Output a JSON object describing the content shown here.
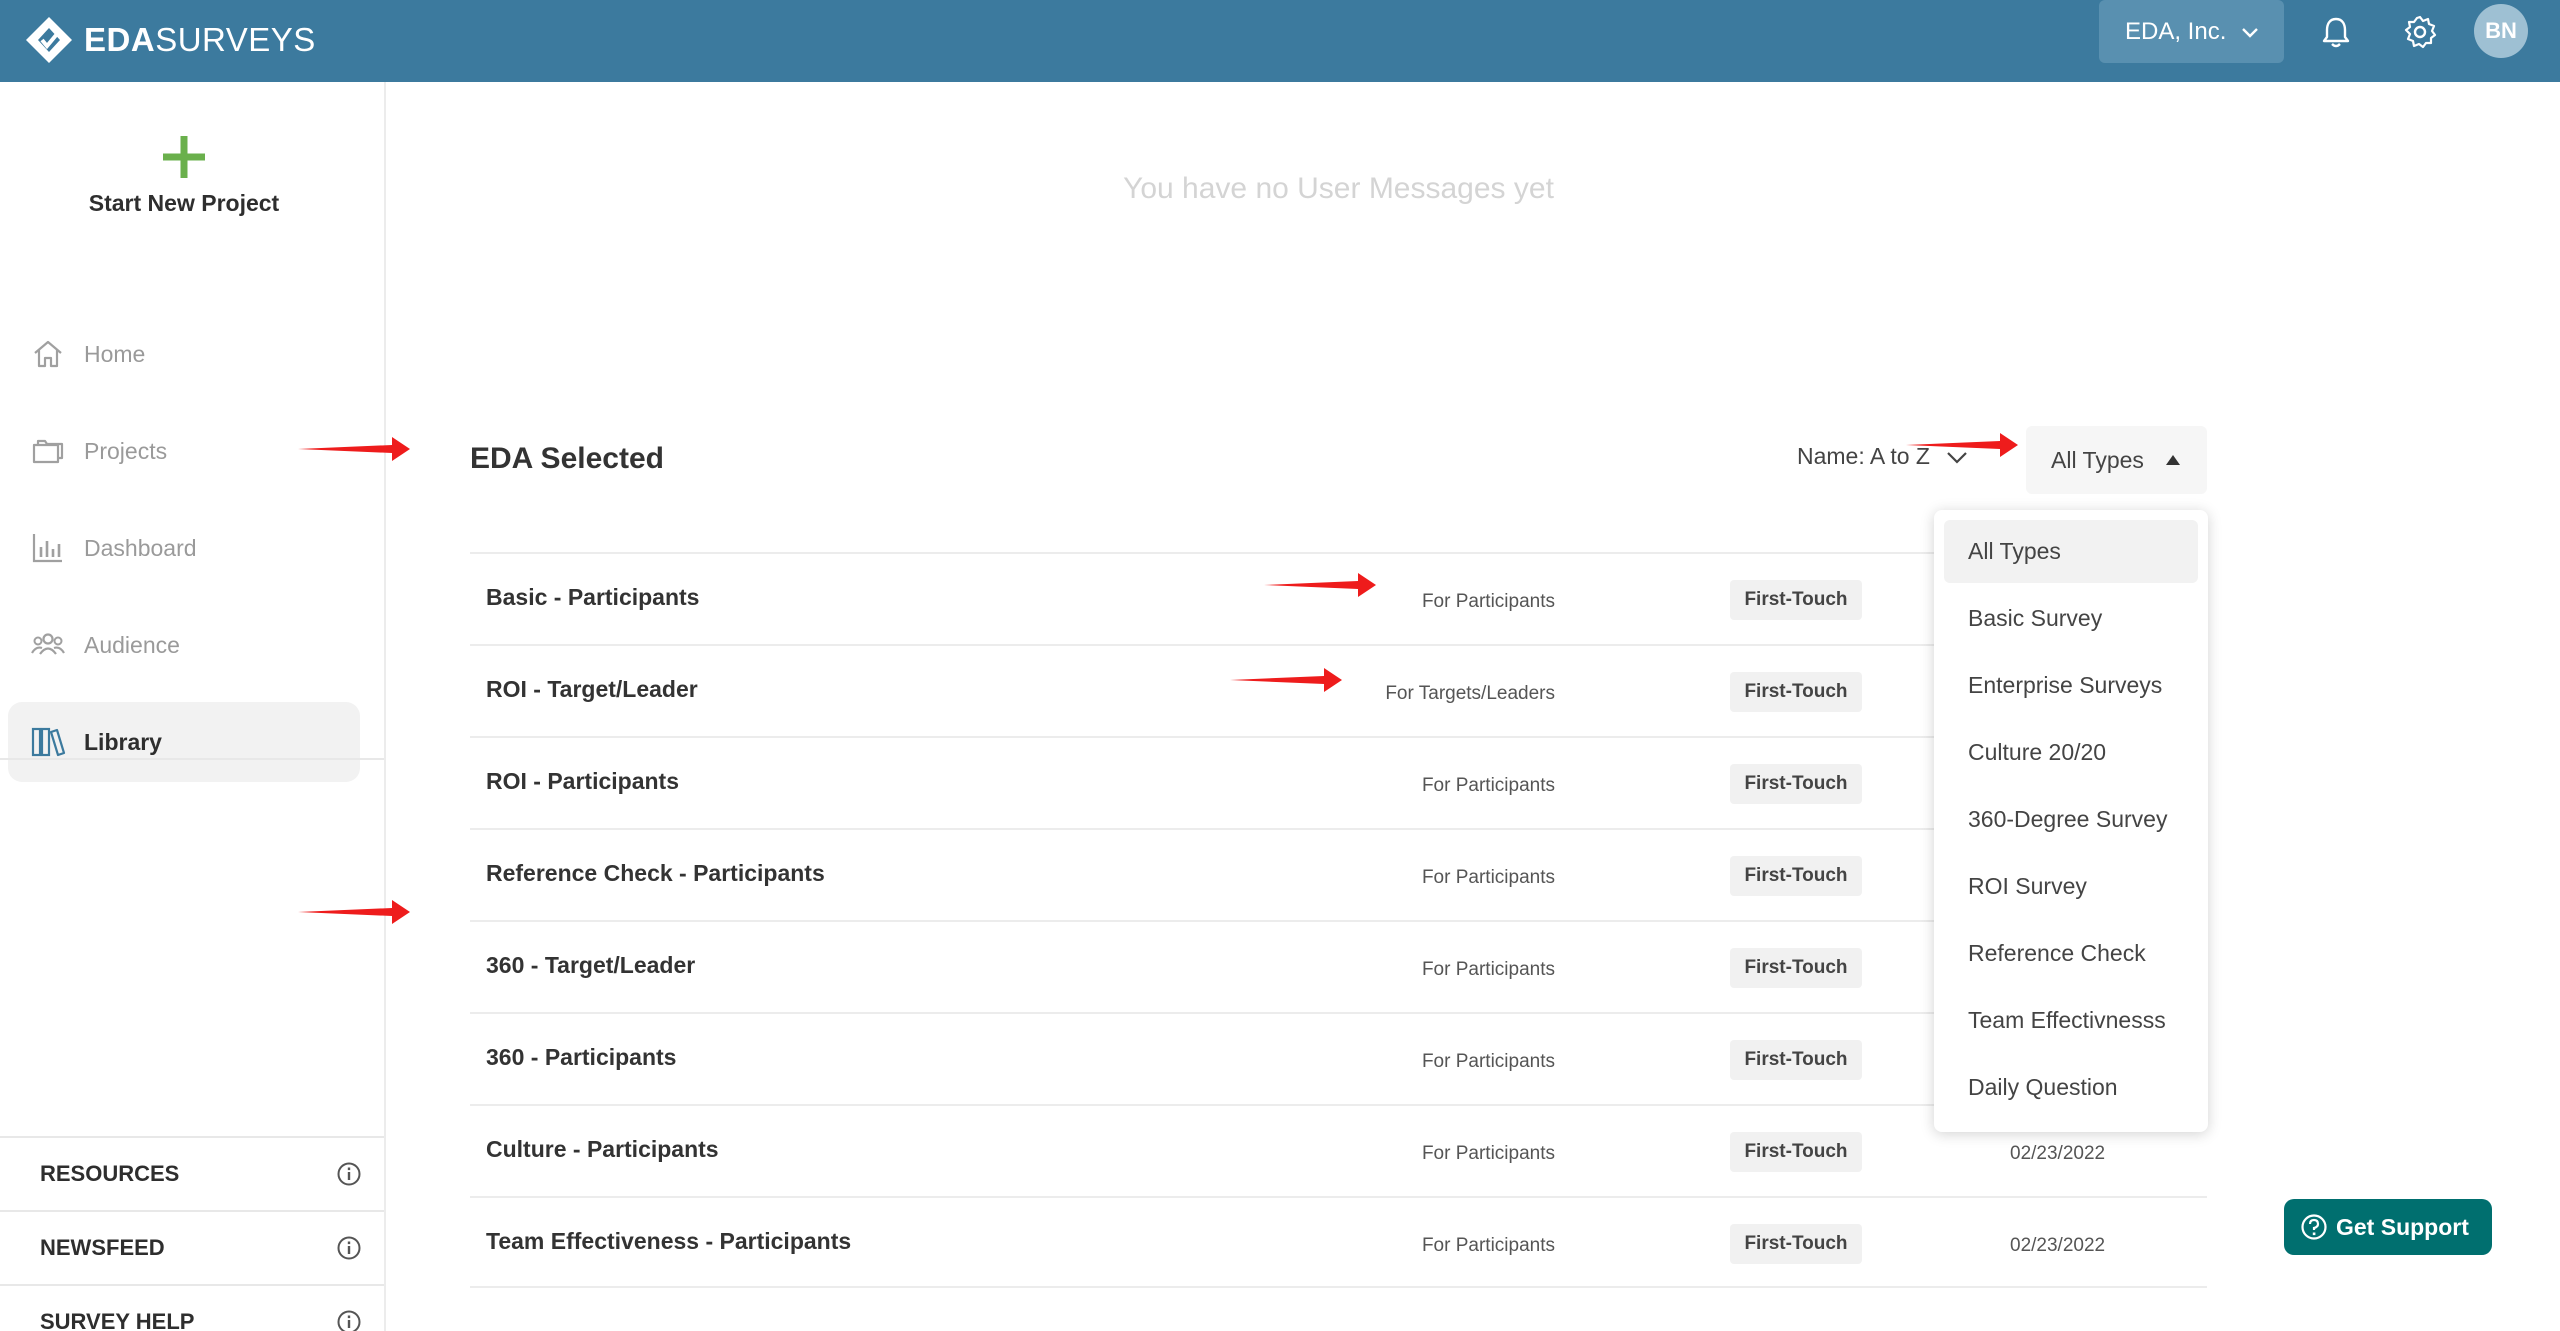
{
  "brand": {
    "name_bold": "EDA",
    "name_regular": "SURVEYS"
  },
  "topbar": {
    "org_label": "EDA, Inc.",
    "avatar_initials": "BN",
    "icons": [
      "bell-icon",
      "gear-icon",
      "chevron-down-icon"
    ]
  },
  "sidebar": {
    "new_project_label": "Start New Project",
    "items": [
      {
        "label": "Home",
        "icon": "home-icon",
        "active": false
      },
      {
        "label": "Projects",
        "icon": "folder-icon",
        "active": false
      },
      {
        "label": "Dashboard",
        "icon": "bar-chart-icon",
        "active": false
      },
      {
        "label": "Audience",
        "icon": "people-icon",
        "active": false
      },
      {
        "label": "Library",
        "icon": "books-icon",
        "active": true
      }
    ],
    "resources": [
      {
        "label": "RESOURCES"
      },
      {
        "label": "NEWSFEED"
      },
      {
        "label": "SURVEY HELP"
      }
    ]
  },
  "main": {
    "empty_message": "You have no User Messages yet",
    "section_title": "EDA Selected",
    "sort_label": "Name: A to Z",
    "type_filter_label": "All Types",
    "rows": [
      {
        "name": "Basic - Participants",
        "audience": "For Participants",
        "tag": "First-Touch",
        "date": ""
      },
      {
        "name": "ROI - Target/Leader",
        "audience": "For Targets/Leaders",
        "tag": "First-Touch",
        "date": ""
      },
      {
        "name": "ROI - Participants",
        "audience": "For Participants",
        "tag": "First-Touch",
        "date": ""
      },
      {
        "name": "Reference Check - Participants",
        "audience": "For Participants",
        "tag": "First-Touch",
        "date": ""
      },
      {
        "name": "360 - Target/Leader",
        "audience": "For Participants",
        "tag": "First-Touch",
        "date": ""
      },
      {
        "name": "360 - Participants",
        "audience": "For Participants",
        "tag": "First-Touch",
        "date": ""
      },
      {
        "name": "Culture - Participants",
        "audience": "For Participants",
        "tag": "First-Touch",
        "date": "02/23/2022"
      },
      {
        "name": "Team Effectiveness - Participants",
        "audience": "For Participants",
        "tag": "First-Touch",
        "date": "02/23/2022"
      }
    ]
  },
  "type_dropdown": {
    "selected": "All Types",
    "options": [
      "All Types",
      "Basic Survey",
      "Enterprise Surveys",
      "Culture 20/20",
      "360-Degree Survey",
      "ROI Survey",
      "Reference Check",
      "Team Effectivnesss",
      "Daily Question"
    ]
  },
  "support": {
    "label": "Get Support"
  },
  "colors": {
    "topbar": "#3c7a9e",
    "org_select": "#5990b0",
    "plus_green": "#6ab04c",
    "support_teal": "#006f6f",
    "annotation_red": "#ee1c1c"
  }
}
